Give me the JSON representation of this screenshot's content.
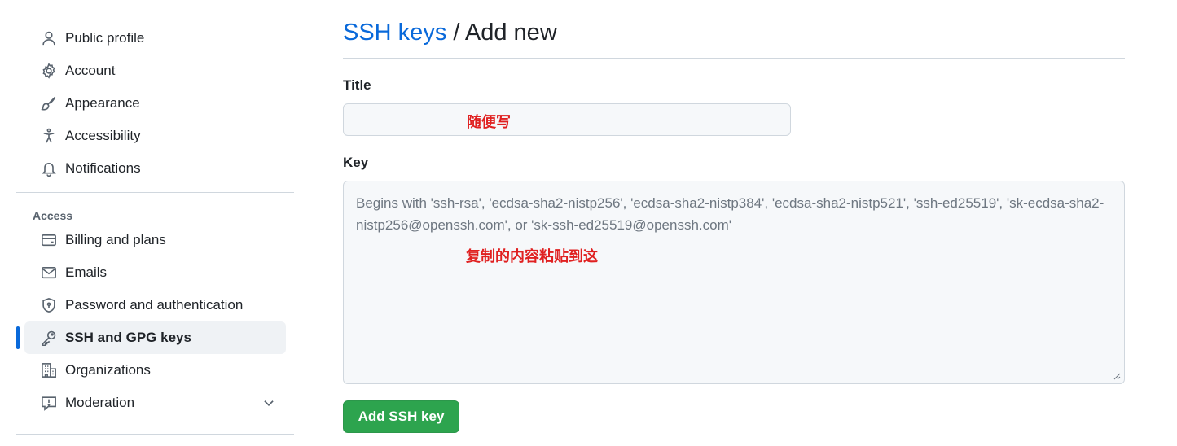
{
  "sidebar": {
    "items_top": [
      {
        "label": "Public profile",
        "icon": "person-icon"
      },
      {
        "label": "Account",
        "icon": "gear-icon"
      },
      {
        "label": "Appearance",
        "icon": "paintbrush-icon"
      },
      {
        "label": "Accessibility",
        "icon": "accessibility-icon"
      },
      {
        "label": "Notifications",
        "icon": "bell-icon"
      }
    ],
    "access_heading": "Access",
    "items_access": [
      {
        "label": "Billing and plans",
        "icon": "credit-card-icon"
      },
      {
        "label": "Emails",
        "icon": "mail-icon"
      },
      {
        "label": "Password and authentication",
        "icon": "shield-icon"
      },
      {
        "label": "SSH and GPG keys",
        "icon": "key-icon",
        "active": true
      },
      {
        "label": "Organizations",
        "icon": "organization-icon"
      },
      {
        "label": "Moderation",
        "icon": "report-icon"
      }
    ]
  },
  "main": {
    "breadcrumb_link": "SSH keys",
    "breadcrumb_rest": " / Add new",
    "title_label": "Title",
    "title_annotation": "随便写",
    "key_label": "Key",
    "key_placeholder": "Begins with 'ssh-rsa', 'ecdsa-sha2-nistp256', 'ecdsa-sha2-nistp384', 'ecdsa-sha2-nistp521', 'ssh-ed25519', 'sk-ecdsa-sha2-nistp256@openssh.com', or 'sk-ssh-ed25519@openssh.com'",
    "key_annotation": "复制的内容粘贴到这",
    "submit_label": "Add SSH key"
  },
  "colors": {
    "link": "#0969da",
    "primary_button": "#2da44e",
    "annotation": "#e02020",
    "active_indicator": "#0969da"
  }
}
